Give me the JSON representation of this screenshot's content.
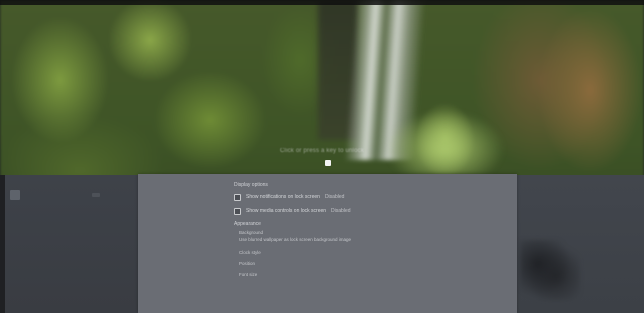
{
  "screen": {
    "description_free": true
  },
  "lock_screen": {
    "caption": "Click or press a key to unlock",
    "pointer_icon": "pointer-cursor-icon"
  },
  "dialog": {
    "header": "Display options",
    "rows": [
      {
        "label": "Show notifications on lock screen",
        "value": "Disabled"
      },
      {
        "label": "Show media controls on lock screen",
        "value": "Disabled"
      }
    ],
    "section": "Appearance",
    "items": [
      "Background",
      "Use blurred wallpaper as lock screen background image",
      "Clock style",
      "Position",
      "Font size"
    ]
  },
  "colors": {
    "panel": "#3e4249",
    "dialog": "#6a6d74",
    "text": "#d4d6d9"
  }
}
